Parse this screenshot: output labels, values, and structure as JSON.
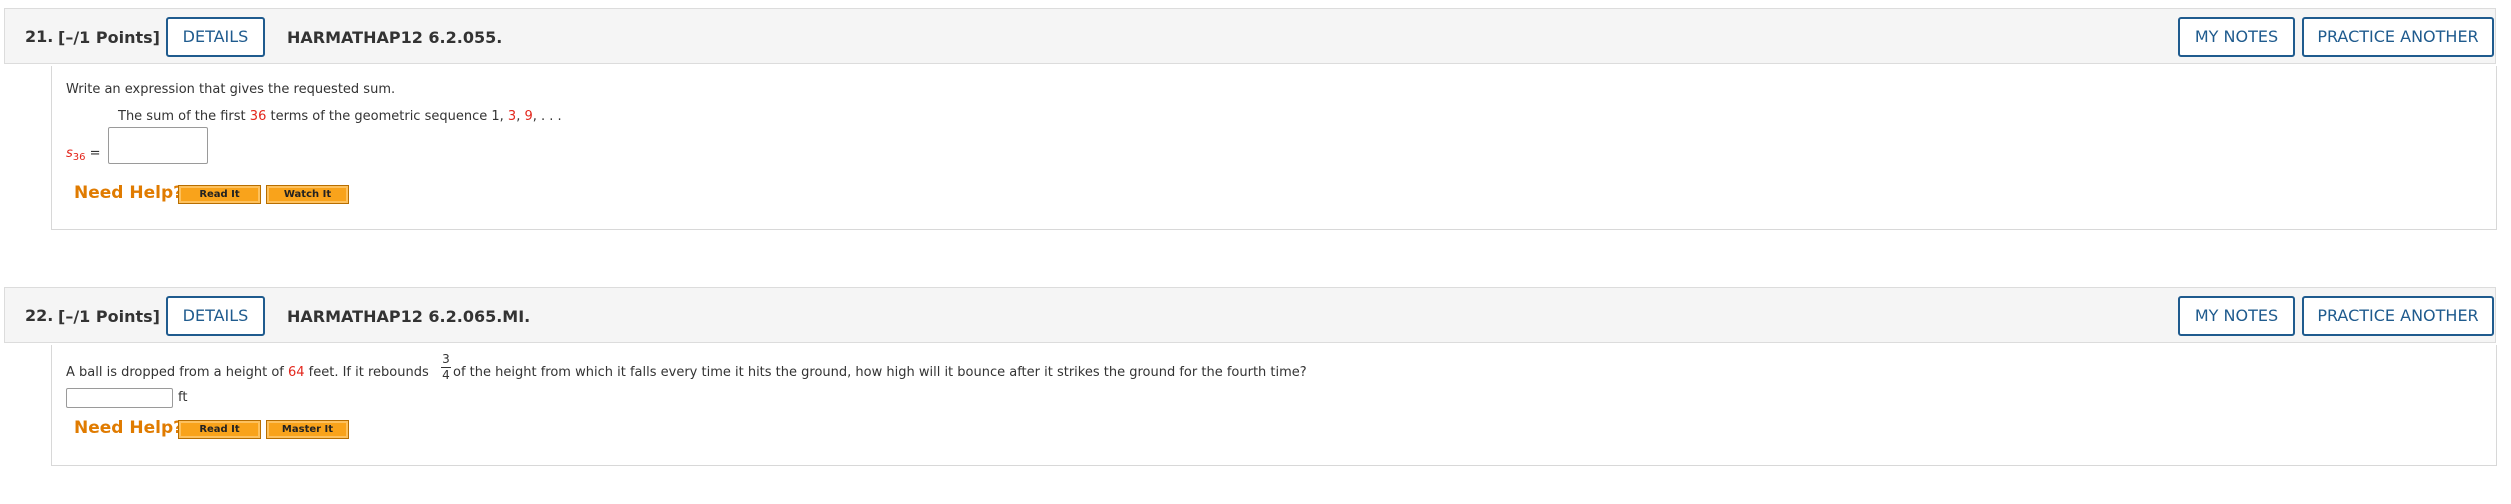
{
  "questions": [
    {
      "number": "21.",
      "points": "[–/1 Points]",
      "details_label": "DETAILS",
      "code": "HARMATHAP12 6.2.055.",
      "my_notes_label": "MY NOTES",
      "practice_label": "PRACTICE ANOTHER",
      "instruction": "Write an expression that gives the requested sum.",
      "prompt_part1": "The sum of the first ",
      "prompt_n": "36",
      "prompt_part2": " terms of the geometric sequence 1, ",
      "prompt_t2": "3",
      "prompt_comma": ", ",
      "prompt_t3": "9",
      "prompt_part3": ", . . .",
      "answer_var": "s",
      "answer_sub": "36",
      "answer_eq": " =",
      "answer_value": "",
      "need_help": "Need Help?",
      "help_buttons": [
        "Read It",
        "Watch It"
      ]
    },
    {
      "number": "22.",
      "points": "[–/1 Points]",
      "details_label": "DETAILS",
      "code": "HARMATHAP12 6.2.065.MI.",
      "my_notes_label": "MY NOTES",
      "practice_label": "PRACTICE ANOTHER",
      "prompt_part1": "A ball is dropped from a height of ",
      "prompt_height": "64",
      "prompt_part2": " feet. If it rebounds ",
      "frac_num": "3",
      "frac_den": "4",
      "prompt_part3": " of the height from which it falls every time it hits the ground, how high will it bounce after it strikes the ground for the fourth time?",
      "answer_value": "",
      "answer_unit": "ft",
      "need_help": "Need Help?",
      "help_buttons": [
        "Read It",
        "Master It"
      ]
    }
  ],
  "colors": {
    "accent_blue": "#1f5b8e",
    "highlight_red": "#e3261c",
    "help_orange": "#e07b00",
    "button_orange": "#f9a31b"
  }
}
